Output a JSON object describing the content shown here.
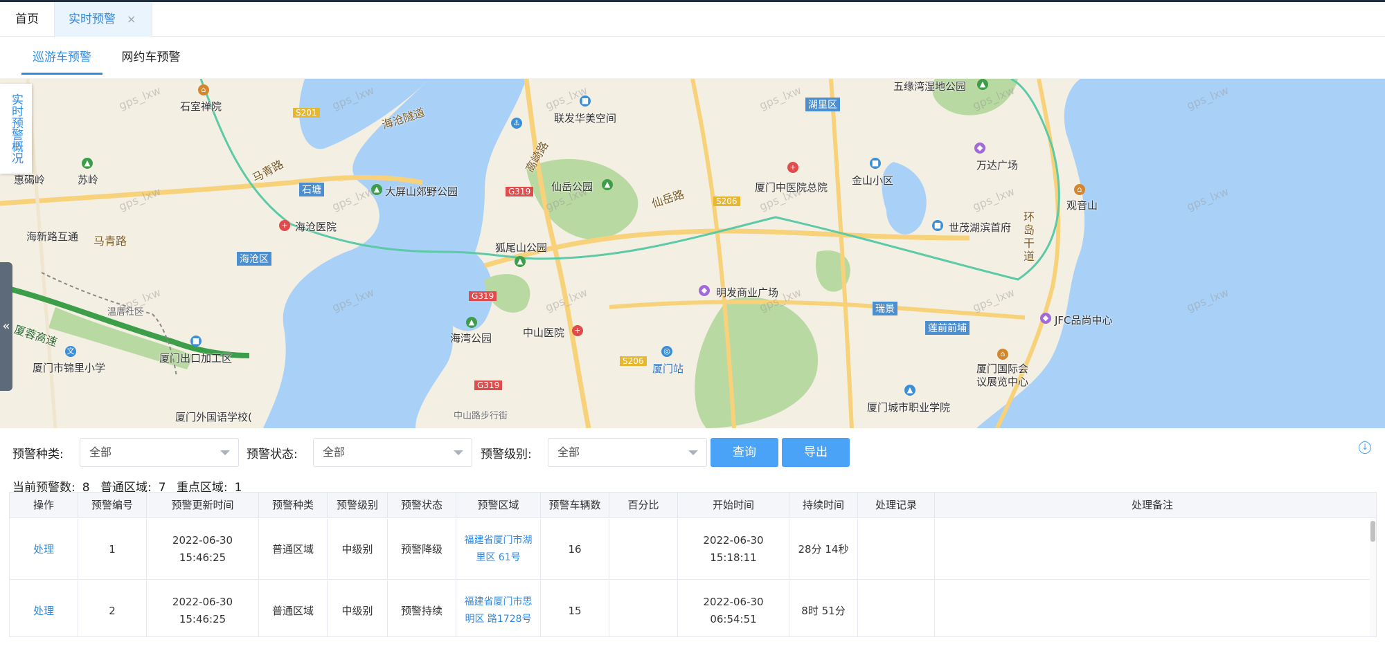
{
  "page_tabs": {
    "home": "首页",
    "active": "实时预警",
    "close": "×"
  },
  "sub_tabs": [
    "巡游车预警",
    "网约车预警"
  ],
  "map": {
    "overview_label": "实时预警概况",
    "collapse_icon": "«",
    "watermark": "gps_lxw",
    "labels": {
      "shishi_chanyuan": "石室禅院",
      "haicang_tunnel": "海沧隧道",
      "lianfa": "联发华美空间",
      "wuyuanwan": "五缘湾湿地公园",
      "huli": "湖里区",
      "huiweiling": "惠碣岭",
      "suling": "苏岭",
      "s201": "S201",
      "maqing_road1": "马青路",
      "shitang": "石塘",
      "dapingshan": "大屏山郊野公园",
      "xianyue_park": "仙岳公园",
      "g319_1": "G319",
      "xiamen_tcm": "厦门中医院总院",
      "jinshan": "金山小区",
      "xianyue_road": "仙岳路",
      "s206_1": "S206",
      "wanda": "万达广场",
      "guanyinshan": "观音山",
      "haicang_hospital": "海沧医院",
      "haixin_interchange": "海新路互通",
      "maqing_road2": "马青路",
      "huweishan": "狐尾山公园",
      "shimao": "世茂湖滨首府",
      "huandao": "环岛干道",
      "haicang_district": "海沧区",
      "g319_2": "G319",
      "mingfa": "明发商业广场",
      "ruijing": "瑞景",
      "lianqian": "莲前前埔",
      "jfc": "JFC品尚中心",
      "wenlan": "温厝社区",
      "xiarong": "厦蓉高速",
      "haiwan": "海湾公园",
      "zhongshan_hospital": "中山医院",
      "jinli": "厦门市锦里小学",
      "export_zone": "厦门出口加工区",
      "s206_2": "S206",
      "xiamen_station": "厦门站",
      "convention": "厦门国际会议展览中心",
      "g319_3": "G319",
      "foreign_school": "厦门外国语学校(",
      "zhongshan_street": "中山路步行街",
      "vocational": "厦门城市职业学院",
      "gaoqi": "高崎路"
    }
  },
  "filters": {
    "type_label": "预警种类:",
    "type_value": "全部",
    "status_label": "预警状态:",
    "status_value": "全部",
    "level_label": "预警级别:",
    "level_value": "全部",
    "query_button": "查询",
    "export_button": "导出",
    "download_icon": "↓"
  },
  "summary": {
    "current_label": "当前预警数:",
    "current_value": "8",
    "normal_label": "普通区域:",
    "normal_value": "7",
    "key_label": "重点区域:",
    "key_value": "1"
  },
  "table": {
    "headers": [
      "操作",
      "预警编号",
      "预警更新时间",
      "预警种类",
      "预警级别",
      "预警状态",
      "预警区域",
      "预警车辆数",
      "百分比",
      "开始时间",
      "持续时间",
      "处理记录",
      "处理备注"
    ],
    "rows": [
      {
        "action": "处理",
        "id": "1",
        "update_time": "2022-06-30 15:46:25",
        "type": "普通区域",
        "level": "中级别",
        "status": "预警降级",
        "area": "福建省厦门市湖里区 61号",
        "count": "16",
        "percent": "",
        "start": "2022-06-30 15:18:11",
        "duration": "28分 14秒",
        "record": "",
        "note": ""
      },
      {
        "action": "处理",
        "id": "2",
        "update_time": "2022-06-30 15:46:25",
        "type": "普通区域",
        "level": "中级别",
        "status": "预警持续",
        "area": "福建省厦门市思明区 路1728号",
        "count": "15",
        "percent": "",
        "start": "2022-06-30 06:54:51",
        "duration": "8时 51分",
        "record": "",
        "note": ""
      }
    ]
  },
  "colors": {
    "accent": "#2f8ae5",
    "button": "#4aa3f7",
    "water": "#a9d1f7",
    "green": "#b8d9a1",
    "road": "#f7d27a"
  }
}
